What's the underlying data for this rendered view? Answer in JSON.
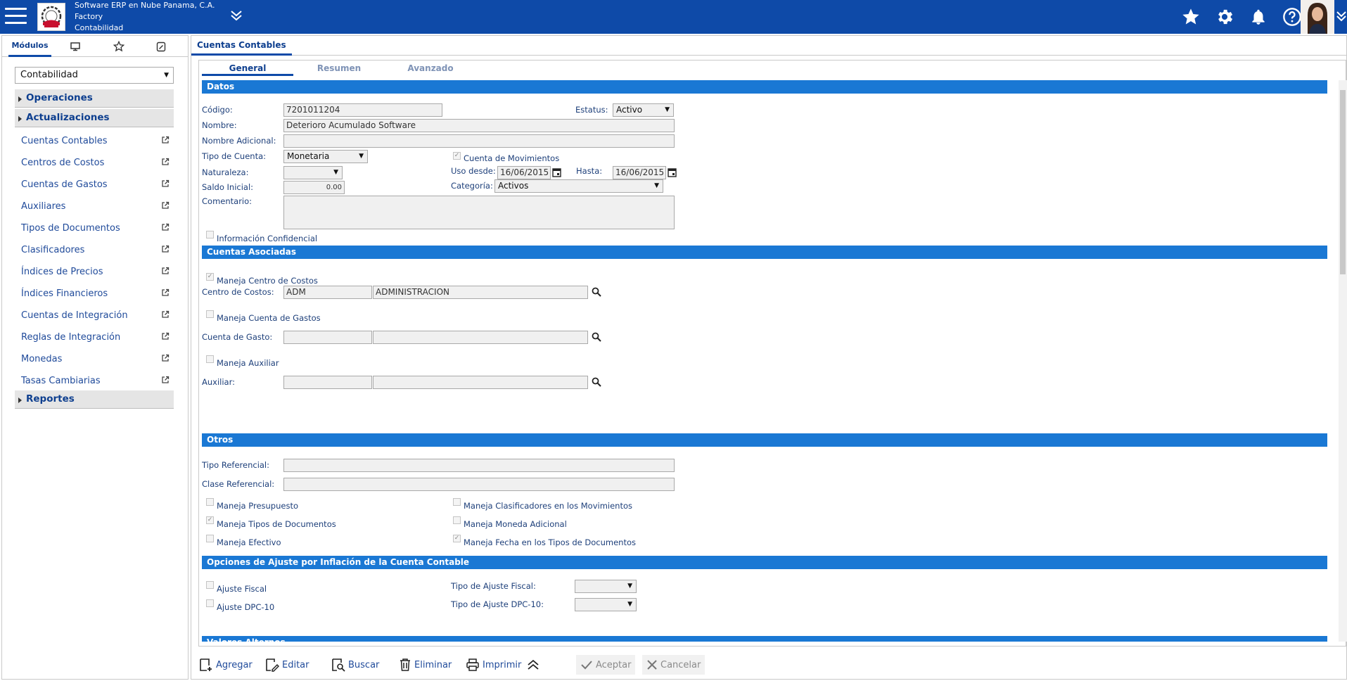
{
  "header": {
    "company": "Software ERP en Nube Panama, C.A.",
    "branch": "Factory",
    "module": "Contabilidad"
  },
  "sidebar": {
    "tab_modules": "Módulos",
    "module_selected": "Contabilidad",
    "sections": {
      "operaciones": "Operaciones",
      "actualizaciones": "Actualizaciones",
      "reportes": "Reportes"
    },
    "items": [
      "Cuentas Contables",
      "Centros de Costos",
      "Cuentas de Gastos",
      "Auxiliares",
      "Tipos de Documentos",
      "Clasificadores",
      "Índices de Precios",
      "Índices Financieros",
      "Cuentas de Integración",
      "Reglas de Integración",
      "Monedas",
      "Tasas Cambiarias"
    ]
  },
  "main": {
    "tab": "Cuentas Contables",
    "inner_tabs": [
      "General",
      "Resumen",
      "Avanzado"
    ]
  },
  "form": {
    "datos": {
      "title": "Datos",
      "codigo_label": "Código:",
      "codigo": "7201011204",
      "estatus_label": "Estatus:",
      "estatus": "Activo",
      "nombre_label": "Nombre:",
      "nombre": "Deterioro Acumulado Software",
      "nombre_adicional_label": "Nombre Adicional:",
      "nombre_adicional": "",
      "tipo_cuenta_label": "Tipo de Cuenta:",
      "tipo_cuenta": "Monetaria",
      "cuenta_movimientos_label": "Cuenta de Movimientos",
      "naturaleza_label": "Naturaleza:",
      "naturaleza": "",
      "uso_desde_label": "Uso desde:",
      "uso_desde": "16/06/2015",
      "hasta_label": "Hasta:",
      "hasta": "16/06/2015",
      "saldo_inicial_label": "Saldo Inicial:",
      "saldo_inicial": "0.00",
      "categoria_label": "Categoría:",
      "categoria": "Activos",
      "comentario_label": "Comentario:",
      "info_confidencial_label": "Información Confidencial"
    },
    "asociadas": {
      "title": "Cuentas Asociadas",
      "maneja_cc_label": "Maneja Centro de Costos",
      "centro_costos_label": "Centro de Costos:",
      "centro_costos_code": "ADM",
      "centro_costos_name": "ADMINISTRACION",
      "maneja_cg_label": "Maneja Cuenta de Gastos",
      "cuenta_gasto_label": "Cuenta de Gasto:",
      "cuenta_gasto_code": "",
      "cuenta_gasto_name": "",
      "maneja_aux_label": "Maneja Auxiliar",
      "auxiliar_label": "Auxiliar:",
      "auxiliar_code": "",
      "auxiliar_name": ""
    },
    "otros": {
      "title": "Otros",
      "tipo_ref_label": "Tipo Referencial:",
      "tipo_ref": "",
      "clase_ref_label": "Clase Referencial:",
      "clase_ref": "",
      "maneja_presupuesto": "Maneja Presupuesto",
      "maneja_clasificadores": "Maneja Clasificadores en los Movimientos",
      "maneja_tipos_docs": "Maneja Tipos de Documentos",
      "maneja_moneda_adicional": "Maneja Moneda Adicional",
      "maneja_efectivo": "Maneja Efectivo",
      "maneja_fecha_tipos_docs": "Maneja Fecha en los Tipos de Documentos"
    },
    "ajuste": {
      "title": "Opciones de Ajuste por Inflación de la Cuenta Contable",
      "ajuste_fiscal_label": "Ajuste Fiscal",
      "tipo_ajuste_fiscal_label": "Tipo de Ajuste Fiscal:",
      "tipo_ajuste_fiscal": "",
      "ajuste_dpc_label": "Ajuste DPC-10",
      "tipo_ajuste_dpc_label": "Tipo de Ajuste DPC-10:",
      "tipo_ajuste_dpc": ""
    },
    "valores_alternos": {
      "title": "Valores Alternos"
    }
  },
  "actions": {
    "agregar": "Agregar",
    "editar": "Editar",
    "buscar": "Buscar",
    "eliminar": "Eliminar",
    "imprimir": "Imprimir",
    "aceptar": "Aceptar",
    "cancelar": "Cancelar"
  },
  "colors": {
    "header_bg": "#0e4aa8",
    "section_bar": "#1a78d4",
    "text": "#1d3f7a"
  }
}
